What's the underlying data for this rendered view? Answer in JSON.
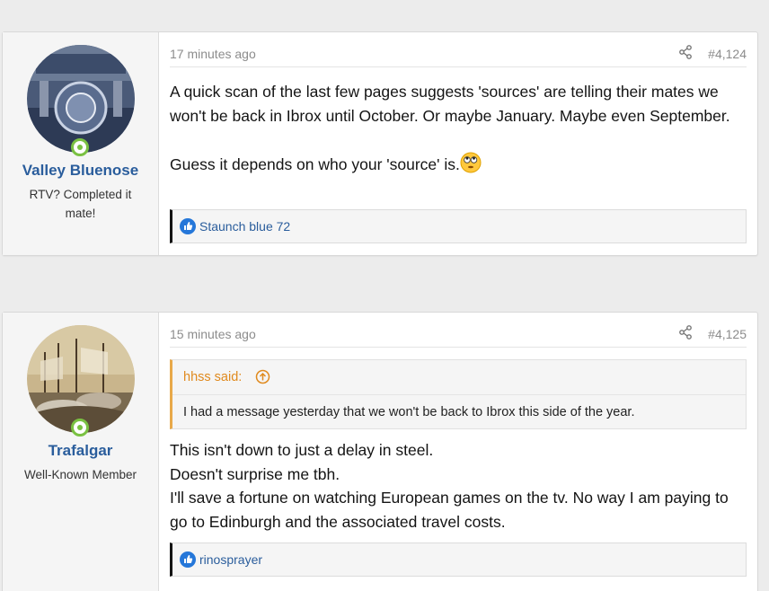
{
  "posts": [
    {
      "author": "Valley Bluenose",
      "user_title": "RTV? Completed it mate!",
      "time": "17 minutes ago",
      "number": "#4,124",
      "body": [
        "A quick scan of the last few pages suggests 'sources' are telling their mates we won't be back in Ibrox until October. Or maybe January. Maybe even September.",
        "Guess it depends on who your 'source' is."
      ],
      "reactions": "Staunch blue 72"
    },
    {
      "author": "Trafalgar",
      "user_title": "Well-Known Member",
      "time": "15 minutes ago",
      "number": "#4,125",
      "quote": {
        "author": "hhss said:",
        "text": "I had a message yesterday that we won't be back to Ibrox this side of the year."
      },
      "body": [
        "This isn't down to just a delay in steel.",
        "Doesn't surprise me tbh.",
        "I'll save a fortune on watching European games on the tv. No way I am paying to go to Edinburgh and the associated travel costs."
      ],
      "reactions": "rinosprayer"
    }
  ],
  "colors": {
    "username": "#2a5d9c",
    "online": "#7ac142",
    "quote_accent": "#e8a94a",
    "like": "#2577d9"
  },
  "icons": [
    "share-icon",
    "like-icon",
    "quote-arrow-up-icon",
    "eye-roll-emoji"
  ]
}
